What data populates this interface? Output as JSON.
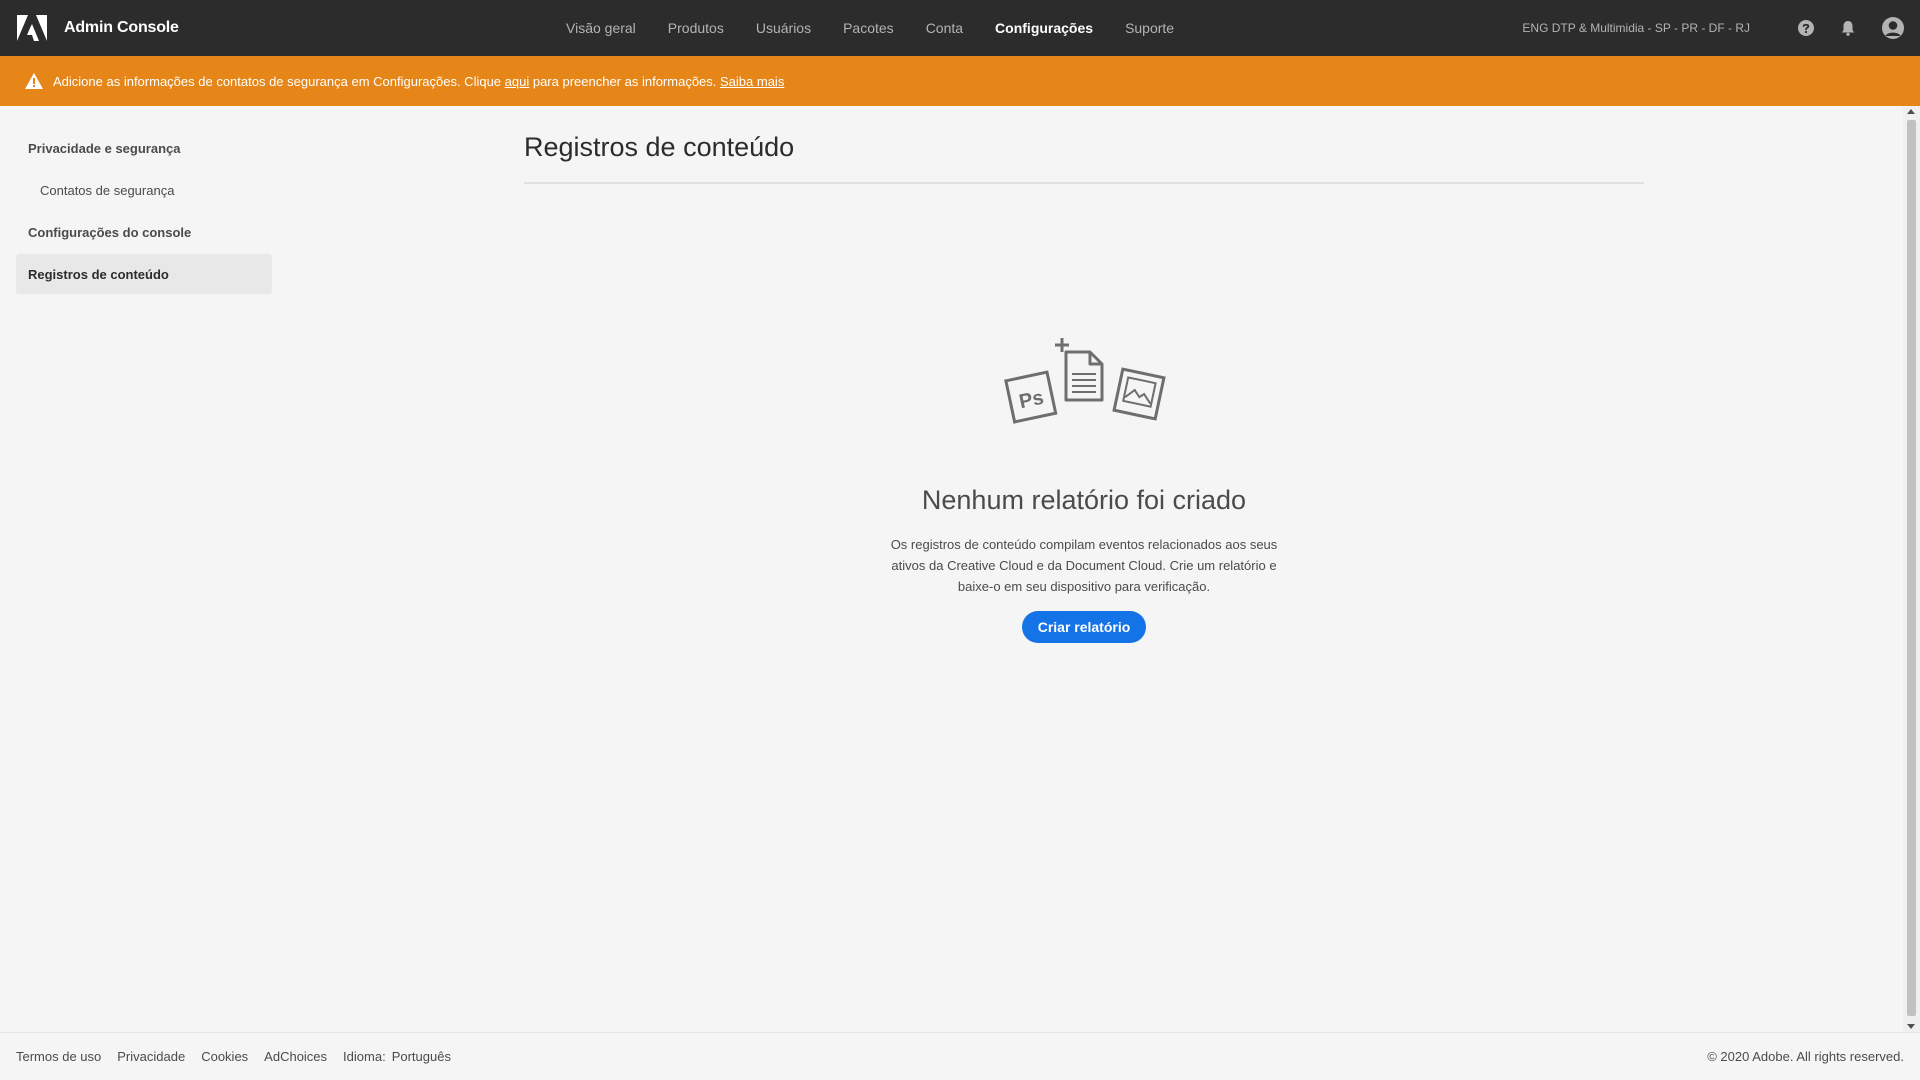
{
  "app": {
    "title": "Admin Console"
  },
  "nav": {
    "items": [
      {
        "label": "Visão geral"
      },
      {
        "label": "Produtos"
      },
      {
        "label": "Usuários"
      },
      {
        "label": "Pacotes"
      },
      {
        "label": "Conta"
      },
      {
        "label": "Configurações",
        "active": true
      },
      {
        "label": "Suporte"
      }
    ]
  },
  "header": {
    "org_name": "ENG DTP & Multimidia - SP - PR - DF - RJ",
    "icons": [
      "help-icon",
      "bell-icon",
      "user-avatar-icon"
    ]
  },
  "alert": {
    "text_before": "Adicione as informações de contatos de segurança em Configurações. Clique ",
    "link_here": "aqui",
    "text_after": " para preencher as informações. ",
    "link_learn_more": "Saiba mais",
    "color": "#e68619"
  },
  "sidebar": {
    "section1": "Privacidade e segurança",
    "section1_items": [
      {
        "label": "Contatos de segurança"
      }
    ],
    "section2": "Configurações do console",
    "section2_items": [
      {
        "label": "Registros de conteúdo",
        "selected": true
      }
    ]
  },
  "main": {
    "title": "Registros de conteúdo",
    "empty_title": "Nenhum relatório foi criado",
    "empty_desc": "Os registros de conteúdo compilam eventos relacionados aos seus ativos da Creative Cloud e da Document Cloud. Crie um relatório e baixe-o em seu dispositivo para verificação.",
    "create_button": "Criar relatório",
    "illustration_badge": "Ps"
  },
  "footer": {
    "links": [
      "Termos de uso",
      "Privacidade",
      "Cookies",
      "AdChoices"
    ],
    "language_label": "Idioma:",
    "language_value": "Português",
    "copyright": "© 2020 Adobe. All rights reserved."
  },
  "colors": {
    "topbar": "#2c2c2c",
    "accent": "#1473e6",
    "warning": "#e68619",
    "background": "#f5f5f5"
  }
}
